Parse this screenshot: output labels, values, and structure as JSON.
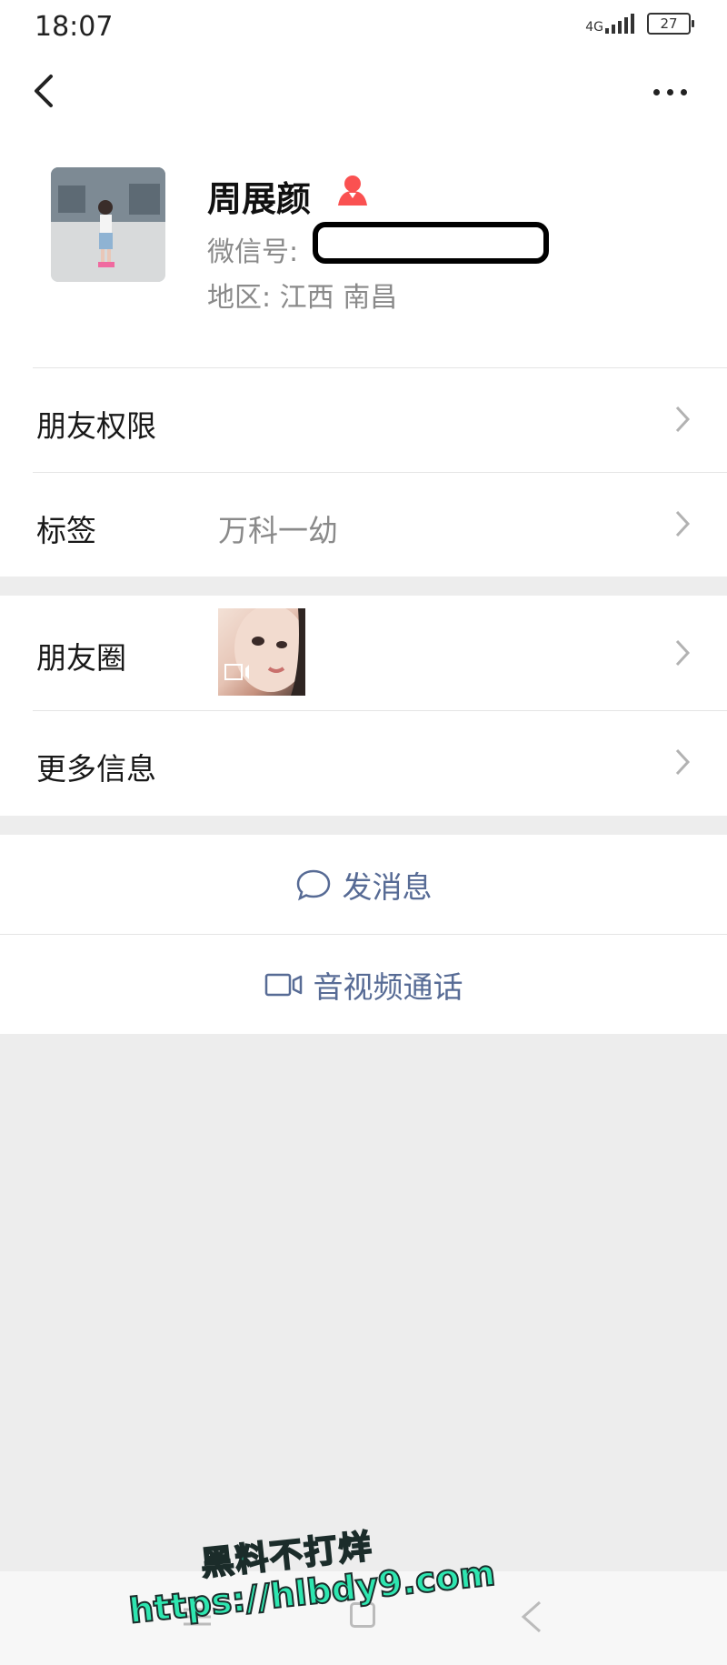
{
  "status_bar": {
    "time": "18:07",
    "network": "4G",
    "battery": "27"
  },
  "nav": {
    "back_icon": "chevron-left-icon",
    "more_icon": "more-dots-icon"
  },
  "profile": {
    "name": "周展颜",
    "gender_icon": "female-icon",
    "gender_color": "#fa5151",
    "wechat_id_label": "微信号:",
    "region_label": "地区:",
    "region_value": "江西 南昌"
  },
  "rows": {
    "permissions": {
      "label": "朋友权限"
    },
    "tags": {
      "label": "标签",
      "value": "万科一幼"
    },
    "moments": {
      "label": "朋友圈"
    },
    "more_info": {
      "label": "更多信息"
    }
  },
  "actions": {
    "send_message": {
      "label": "发消息",
      "icon": "chat-bubble-icon"
    },
    "av_call": {
      "label": "音视频通话",
      "icon": "video-call-icon"
    }
  },
  "colors": {
    "link": "#576b95",
    "background": "#ededed",
    "watermark": "#2ee6b0"
  },
  "watermark": {
    "line1": "黑料不打烊",
    "line2": "https://hlbdy9.com"
  }
}
